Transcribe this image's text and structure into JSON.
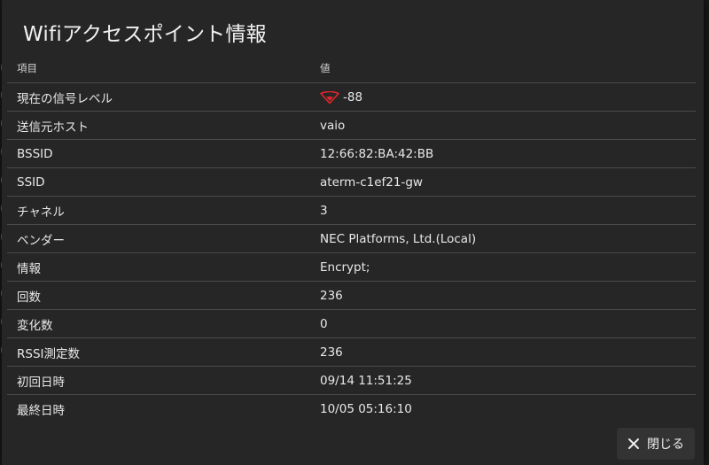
{
  "dialog": {
    "title": "Wifiアクセスポイント情報",
    "close_label": "閉じる"
  },
  "table": {
    "headers": [
      "項目",
      "値"
    ],
    "rows": [
      {
        "label": "現在の信号レベル",
        "value": "-88",
        "icon": "wifi-signal-icon"
      },
      {
        "label": "送信元ホスト",
        "value": "vaio"
      },
      {
        "label": "BSSID",
        "value": "12:66:82:BA:42:BB"
      },
      {
        "label": "SSID",
        "value": "aterm-c1ef21-gw"
      },
      {
        "label": "チャネル",
        "value": "3"
      },
      {
        "label": "ベンダー",
        "value": "NEC Platforms, Ltd.(Local)"
      },
      {
        "label": "情報",
        "value": "Encrypt;"
      },
      {
        "label": "回数",
        "value": "236"
      },
      {
        "label": "変化数",
        "value": "0"
      },
      {
        "label": "RSSI測定数",
        "value": "236"
      },
      {
        "label": "初回日時",
        "value": "09/14 11:51:25"
      },
      {
        "label": "最終日時",
        "value": "10/05 05:16:10"
      }
    ]
  },
  "colors": {
    "signal": "#e0262b",
    "dialog_bg": "#262626",
    "divider": "#4a4a4a"
  }
}
